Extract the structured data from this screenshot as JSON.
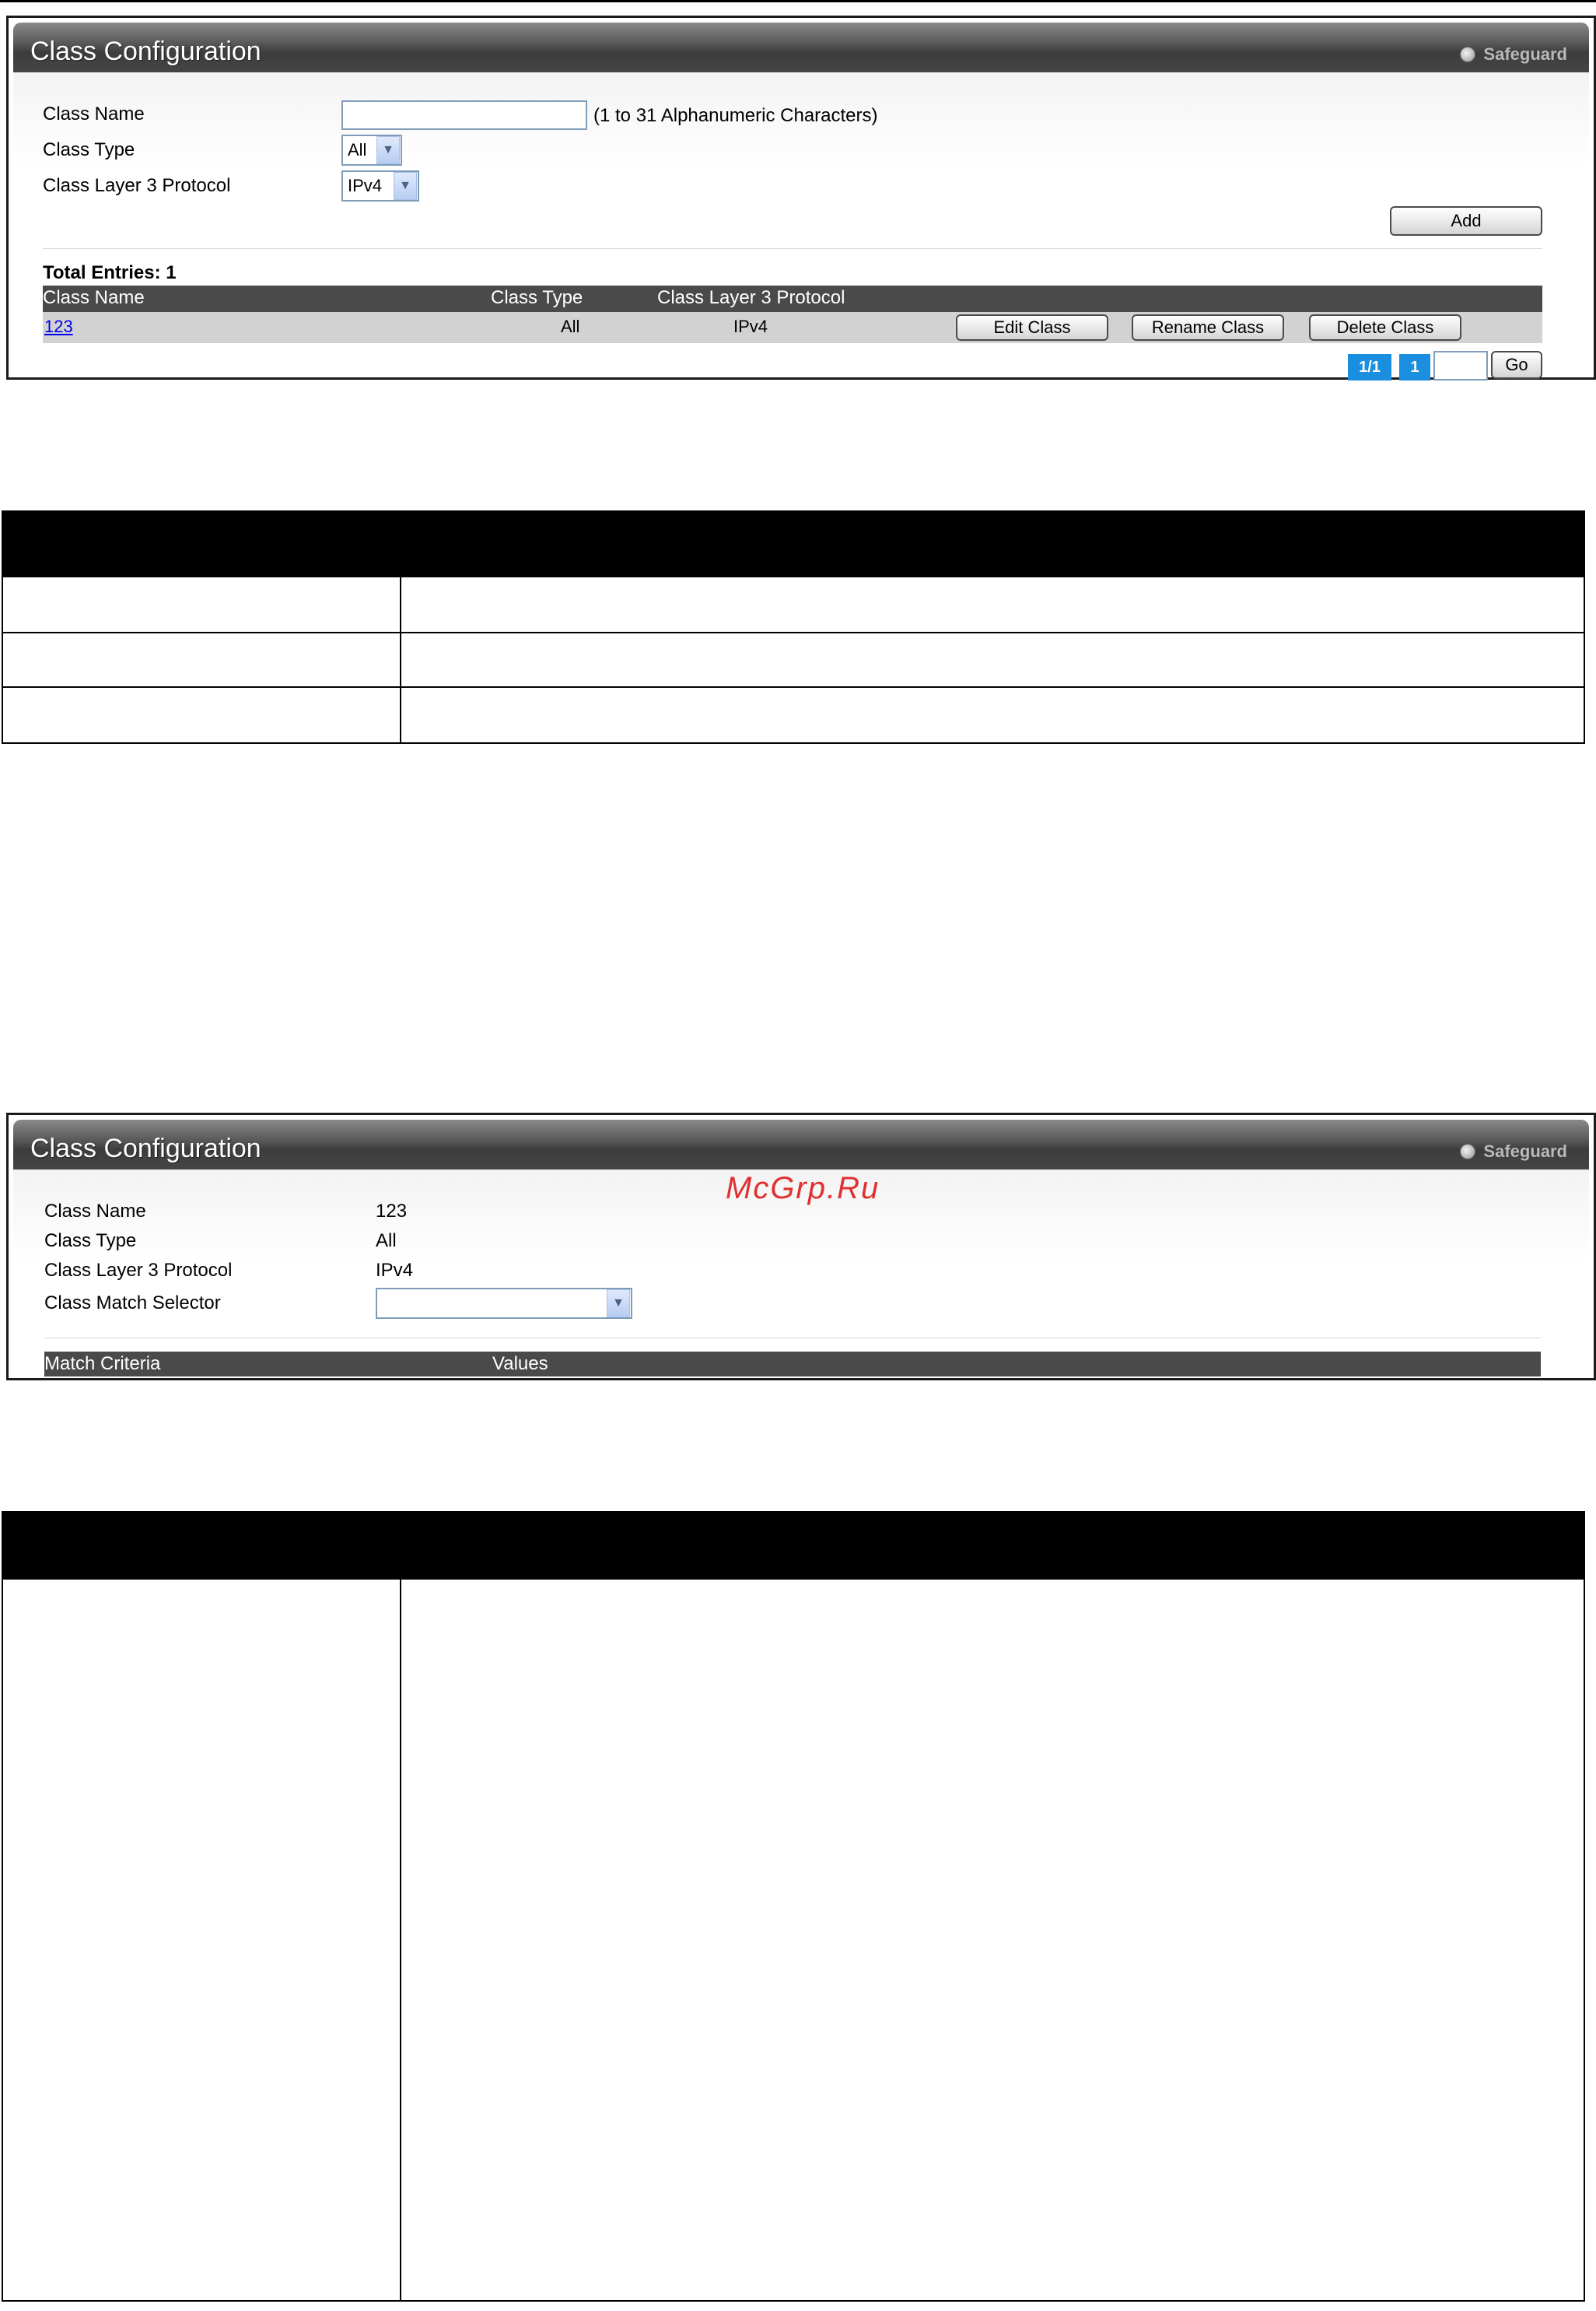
{
  "panel1": {
    "title": "Class Configuration",
    "safeguard": "Safeguard",
    "class_name_label": "Class Name",
    "class_name_value": "",
    "class_name_hint": "(1 to 31 Alphanumeric Characters)",
    "class_type_label": "Class Type",
    "class_type_value": "All",
    "class_l3_label": "Class Layer 3 Protocol",
    "class_l3_value": "IPv4",
    "add_label": "Add",
    "total_entries": "Total Entries: 1",
    "table": {
      "headers": [
        "Class Name",
        "Class Type",
        "Class Layer 3 Protocol"
      ],
      "rows": [
        {
          "name": "123",
          "type": "All",
          "protocol": "IPv4"
        }
      ],
      "edit_label": "Edit Class",
      "rename_label": "Rename Class",
      "delete_label": "Delete Class"
    },
    "pager": {
      "page_info": "1/1",
      "page": "1",
      "go_label": "Go"
    }
  },
  "panel2": {
    "title": "Class Configuration",
    "safeguard": "Safeguard",
    "watermark": "McGrp.Ru",
    "class_name_label": "Class Name",
    "class_name_value": "123",
    "class_type_label": "Class Type",
    "class_type_value": "All",
    "class_l3_label": "Class Layer 3 Protocol",
    "class_l3_value": "IPv4",
    "match_selector_label": "Class Match Selector",
    "match_selector_value": "",
    "table_headers": [
      "Match Criteria",
      "Values"
    ]
  },
  "colors": {
    "header_bar": "#4a4a4a",
    "row_bg": "#d2d2d2",
    "pager_blue": "#1a8fe0",
    "link": "#0000ee",
    "watermark": "#e03030"
  }
}
